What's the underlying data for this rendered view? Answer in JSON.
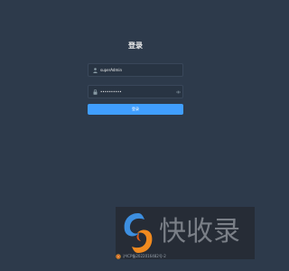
{
  "login": {
    "title": "登录",
    "username": {
      "value": "superAdmin",
      "icon": "user-icon"
    },
    "password": {
      "value": "••••••••••",
      "icon": "lock-icon",
      "toggle_icon": "eye-icon"
    },
    "submit_label": "登录"
  },
  "watermark": {
    "text": "快收录",
    "logo": "kuaishoulu-logo"
  },
  "footer": {
    "beian_text": "沪ICP备2022016482号-2",
    "beian_icon": "police-badge-icon"
  },
  "colors": {
    "background": "#2d3a4b",
    "input_background": "#283443",
    "accent": "#409eff"
  }
}
